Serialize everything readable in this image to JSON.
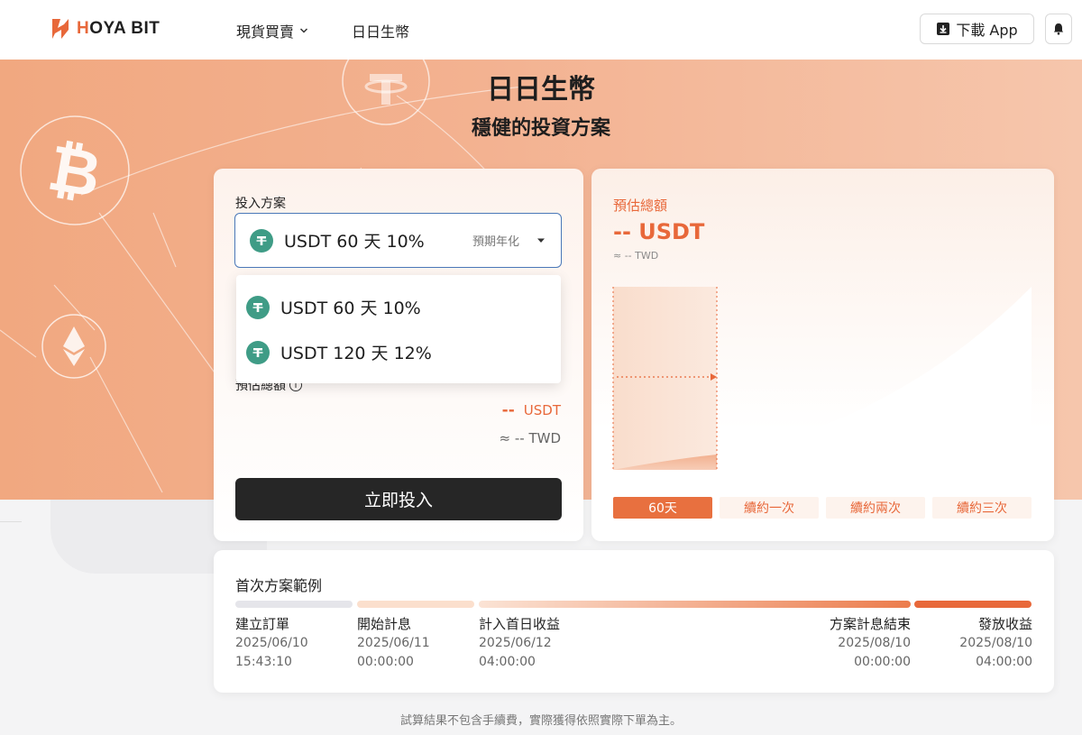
{
  "header": {
    "logo_text": "HOYA BIT",
    "nav": [
      {
        "label": "現貨買賣",
        "has_dropdown": true
      },
      {
        "label": "日日生幣",
        "has_dropdown": false
      }
    ],
    "download_label": "下載 App"
  },
  "hero": {
    "title": "日日生幣",
    "subtitle": "穩健的投資方案"
  },
  "plan_card": {
    "plan_label": "投入方案",
    "selected": "USDT 60 天 10%",
    "select_hint": "預期年化",
    "estimate_label": "預估總額",
    "estimate_usdt_value": "--",
    "estimate_usdt_unit": "USDT",
    "estimate_twd": "≈ -- TWD",
    "invest_button": "立即投入"
  },
  "dropdown": {
    "options": [
      "USDT 60 天 10%",
      "USDT 120 天 12%"
    ]
  },
  "projection_card": {
    "label": "預估總額",
    "usdt": "-- USDT",
    "twd": "≈ -- TWD",
    "tabs": [
      "60天",
      "續約一次",
      "續約兩次",
      "續約三次"
    ],
    "active_tab": 0
  },
  "timeline": {
    "title": "首次方案範例",
    "steps": [
      {
        "name": "建立訂單",
        "date": "2025/06/10",
        "time": "15:43:10"
      },
      {
        "name": "開始計息",
        "date": "2025/06/11",
        "time": "00:00:00"
      },
      {
        "name": "計入首日收益",
        "date": "2025/06/12",
        "time": "04:00:00"
      },
      {
        "name": "方案計息結束",
        "date": "2025/08/10",
        "time": "00:00:00"
      },
      {
        "name": "發放收益",
        "date": "2025/08/10",
        "time": "04:00:00"
      }
    ]
  },
  "footnote": "試算結果不包含手續費，實際獲得依照實際下單為主。",
  "colors": {
    "accent": "#e8683a",
    "tether": "#3f9c86",
    "button_dark": "#262626"
  }
}
